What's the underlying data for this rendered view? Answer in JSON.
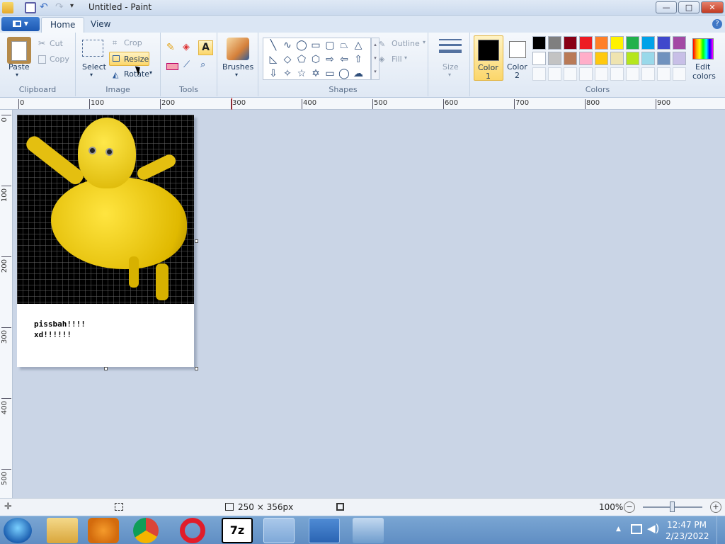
{
  "window": {
    "title": "Untitled - Paint",
    "min": "—",
    "max": "□",
    "close": "✕"
  },
  "tabs": {
    "home": "Home",
    "view": "View"
  },
  "app_menu": "▾",
  "clipboard": {
    "paste": "Paste",
    "cut": "Cut",
    "copy": "Copy",
    "group": "Clipboard"
  },
  "image": {
    "select": "Select",
    "crop": "Crop",
    "resize": "Resize",
    "rotate": "Rotate",
    "group": "Image"
  },
  "tools": {
    "group": "Tools"
  },
  "brushes": {
    "label": "Brushes"
  },
  "shapes": {
    "outline": "Outline",
    "fill": "Fill",
    "group": "Shapes"
  },
  "size": {
    "label": "Size"
  },
  "colors": {
    "color1": "Color 1",
    "color1_short": "Color",
    "color1_num": "1",
    "color2": "Color 2",
    "color2_short": "Color",
    "color2_num": "2",
    "edit": "Edit colors",
    "edit_l1": "Edit",
    "edit_l2": "colors",
    "group": "Colors",
    "row1": [
      "#000000",
      "#7f7f7f",
      "#880015",
      "#ed1c24",
      "#ff7f27",
      "#fff200",
      "#22b14c",
      "#00a2e8",
      "#3f48cc",
      "#a349a4"
    ],
    "row2": [
      "#ffffff",
      "#c3c3c3",
      "#b97a57",
      "#ffaec9",
      "#ffc90e",
      "#efe4b0",
      "#b5e61d",
      "#99d9ea",
      "#7092be",
      "#c8bfe7"
    ]
  },
  "ruler": {
    "h": [
      "0",
      "100",
      "200",
      "300",
      "400",
      "500",
      "600",
      "700",
      "800",
      "900"
    ],
    "v": [
      "0",
      "100",
      "200",
      "300",
      "400",
      "500"
    ]
  },
  "canvas_text": [
    "pissbah!!!!",
    "xd!!!!!!"
  ],
  "status": {
    "dimensions": "250 × 356px",
    "zoom": "100%"
  },
  "taskbar": {
    "time": "12:47 PM",
    "date": "2/23/2022"
  }
}
